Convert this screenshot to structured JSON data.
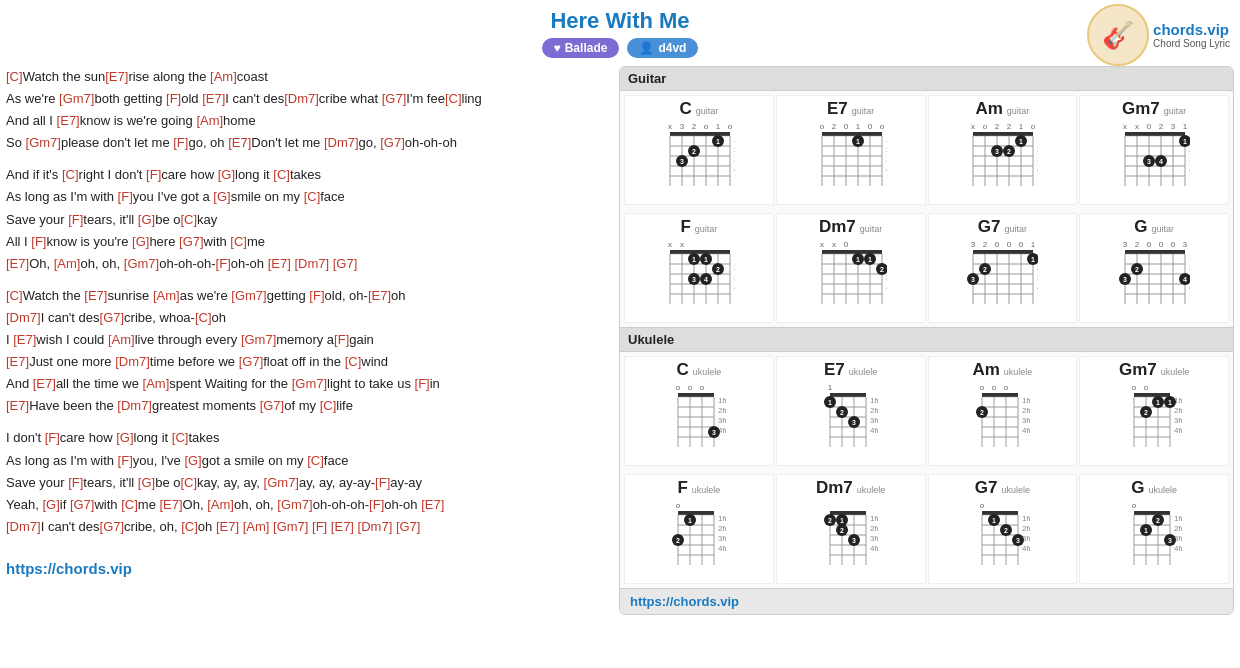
{
  "header": {
    "title": "Here With Me",
    "badge_ballade": "Ballade",
    "badge_user": "d4vd",
    "logo_icon": "🎸",
    "logo_brand": "chords.vip",
    "logo_sub": "Chord Song Lyric"
  },
  "lyrics": {
    "lines": [
      {
        "parts": [
          {
            "text": "[C]",
            "chord": true
          },
          {
            "text": "Watch the sun"
          },
          {
            "text": "[E7]",
            "chord": true
          },
          {
            "text": "rise along the "
          },
          {
            "text": "[Am]",
            "chord": true
          },
          {
            "text": "coast"
          }
        ]
      },
      {
        "parts": [
          {
            "text": "As we're "
          },
          {
            "text": "[Gm7]",
            "chord": true
          },
          {
            "text": "both getting "
          },
          {
            "text": "[F]",
            "chord": true
          },
          {
            "text": "old "
          },
          {
            "text": "[E7]",
            "chord": true
          },
          {
            "text": "I can't des"
          },
          {
            "text": "[Dm7]",
            "chord": true
          },
          {
            "text": "cribe what "
          },
          {
            "text": "[G7]",
            "chord": true
          },
          {
            "text": "I'm fee"
          },
          {
            "text": "[C]",
            "chord": true
          },
          {
            "text": "ling"
          }
        ]
      },
      {
        "parts": [
          {
            "text": "And all I "
          },
          {
            "text": "[E7]",
            "chord": true
          },
          {
            "text": "know is we're going "
          },
          {
            "text": "[Am]",
            "chord": true
          },
          {
            "text": "home"
          }
        ]
      },
      {
        "parts": [
          {
            "text": "So "
          },
          {
            "text": "[Gm7]",
            "chord": true
          },
          {
            "text": "please don't let me "
          },
          {
            "text": "[F]",
            "chord": true
          },
          {
            "text": "go, oh "
          },
          {
            "text": "[E7]",
            "chord": true
          },
          {
            "text": "Don't let me "
          },
          {
            "text": "[Dm7]",
            "chord": true
          },
          {
            "text": "go, "
          },
          {
            "text": "[G7]",
            "chord": true
          },
          {
            "text": "oh-oh-oh"
          }
        ]
      },
      {
        "spacer": true
      },
      {
        "parts": [
          {
            "text": "And if it's "
          },
          {
            "text": "[C]",
            "chord": true
          },
          {
            "text": "right I don't "
          },
          {
            "text": "[F]",
            "chord": true
          },
          {
            "text": "care how "
          },
          {
            "text": "[G]",
            "chord": true
          },
          {
            "text": "long it "
          },
          {
            "text": "[C]",
            "chord": true
          },
          {
            "text": "takes"
          }
        ]
      },
      {
        "parts": [
          {
            "text": "As long as I'm with "
          },
          {
            "text": "[F]",
            "chord": true
          },
          {
            "text": "you I've got a "
          },
          {
            "text": "[G]",
            "chord": true
          },
          {
            "text": "smile on my "
          },
          {
            "text": "[C]",
            "chord": true
          },
          {
            "text": "face"
          }
        ]
      },
      {
        "parts": [
          {
            "text": "Save your "
          },
          {
            "text": "[F]",
            "chord": true
          },
          {
            "text": "tears, it'll "
          },
          {
            "text": "[G]",
            "chord": true
          },
          {
            "text": "be o"
          },
          {
            "text": "[C]",
            "chord": true
          },
          {
            "text": "kay"
          }
        ]
      },
      {
        "parts": [
          {
            "text": "All I "
          },
          {
            "text": "[F]",
            "chord": true
          },
          {
            "text": "know is you're "
          },
          {
            "text": "[G]",
            "chord": true
          },
          {
            "text": "here "
          },
          {
            "text": "[G7]",
            "chord": true
          },
          {
            "text": "with "
          },
          {
            "text": "[C]",
            "chord": true
          },
          {
            "text": "me"
          }
        ]
      },
      {
        "parts": [
          {
            "text": "[E7]",
            "chord": true
          },
          {
            "text": "Oh, "
          },
          {
            "text": "[Am]",
            "chord": true
          },
          {
            "text": "oh, oh, "
          },
          {
            "text": "[Gm7]",
            "chord": true
          },
          {
            "text": "oh-oh-oh-"
          },
          {
            "text": "[F]",
            "chord": true
          },
          {
            "text": "oh-oh "
          },
          {
            "text": "[E7]",
            "chord": true
          },
          {
            "text": " "
          },
          {
            "text": "[Dm7]",
            "chord": true
          },
          {
            "text": " "
          },
          {
            "text": "[G7]",
            "chord": true
          }
        ]
      },
      {
        "spacer": true
      },
      {
        "parts": [
          {
            "text": "[C]",
            "chord": true
          },
          {
            "text": "Watch the "
          },
          {
            "text": "[E7]",
            "chord": true
          },
          {
            "text": "sunrise "
          },
          {
            "text": "[Am]",
            "chord": true
          },
          {
            "text": "as we're "
          },
          {
            "text": "[Gm7]",
            "chord": true
          },
          {
            "text": "getting "
          },
          {
            "text": "[F]",
            "chord": true
          },
          {
            "text": "old, oh-"
          },
          {
            "text": "[E7]",
            "chord": true
          },
          {
            "text": "oh"
          }
        ]
      },
      {
        "parts": [
          {
            "text": "[Dm7]",
            "chord": true
          },
          {
            "text": "I can't des"
          },
          {
            "text": "[G7]",
            "chord": true
          },
          {
            "text": "cribe, whoa-"
          },
          {
            "text": "[C]",
            "chord": true
          },
          {
            "text": "oh"
          }
        ]
      },
      {
        "parts": [
          {
            "text": "I "
          },
          {
            "text": "[E7]",
            "chord": true
          },
          {
            "text": "wish I could "
          },
          {
            "text": "[Am]",
            "chord": true
          },
          {
            "text": "live through every "
          },
          {
            "text": "[Gm7]",
            "chord": true
          },
          {
            "text": "memory a"
          },
          {
            "text": "[F]",
            "chord": true
          },
          {
            "text": "gain"
          }
        ]
      },
      {
        "parts": [
          {
            "text": "[E7]",
            "chord": true
          },
          {
            "text": "Just one more "
          },
          {
            "text": "[Dm7]",
            "chord": true
          },
          {
            "text": "time before we "
          },
          {
            "text": "[G7]",
            "chord": true
          },
          {
            "text": "float off in the "
          },
          {
            "text": "[C]",
            "chord": true
          },
          {
            "text": "wind"
          }
        ]
      },
      {
        "parts": [
          {
            "text": "And "
          },
          {
            "text": "[E7]",
            "chord": true
          },
          {
            "text": "all the time we "
          },
          {
            "text": "[Am]",
            "chord": true
          },
          {
            "text": "spent Waiting for the "
          },
          {
            "text": "[Gm7]",
            "chord": true
          },
          {
            "text": "light to take us "
          },
          {
            "text": "[F]",
            "chord": true
          },
          {
            "text": "in"
          }
        ]
      },
      {
        "parts": [
          {
            "text": "[E7]",
            "chord": true
          },
          {
            "text": "Have been the "
          },
          {
            "text": "[Dm7]",
            "chord": true
          },
          {
            "text": "greatest moments "
          },
          {
            "text": "[G7]",
            "chord": true
          },
          {
            "text": "of my "
          },
          {
            "text": "[C]",
            "chord": true
          },
          {
            "text": "life"
          }
        ]
      },
      {
        "spacer": true
      },
      {
        "parts": [
          {
            "text": "I don't "
          },
          {
            "text": "[F]",
            "chord": true
          },
          {
            "text": "care how "
          },
          {
            "text": "[G]",
            "chord": true
          },
          {
            "text": "long it "
          },
          {
            "text": "[C]",
            "chord": true
          },
          {
            "text": "takes"
          }
        ]
      },
      {
        "parts": [
          {
            "text": "As long as I'm with "
          },
          {
            "text": "[F]",
            "chord": true
          },
          {
            "text": "you, I've "
          },
          {
            "text": "[G]",
            "chord": true
          },
          {
            "text": "got a smile on my "
          },
          {
            "text": "[C]",
            "chord": true
          },
          {
            "text": "face"
          }
        ]
      },
      {
        "parts": [
          {
            "text": "Save your "
          },
          {
            "text": "[F]",
            "chord": true
          },
          {
            "text": "tears, it'll "
          },
          {
            "text": "[G]",
            "chord": true
          },
          {
            "text": "be o"
          },
          {
            "text": "[C]",
            "chord": true
          },
          {
            "text": "kay, ay, ay, "
          },
          {
            "text": "[Gm7]",
            "chord": true
          },
          {
            "text": "ay, ay, ay-ay-"
          },
          {
            "text": "[F]",
            "chord": true
          },
          {
            "text": "ay-ay"
          }
        ]
      },
      {
        "parts": [
          {
            "text": "Yeah, "
          },
          {
            "text": "[G]",
            "chord": true
          },
          {
            "text": "if "
          },
          {
            "text": "[G7]",
            "chord": true
          },
          {
            "text": "with "
          },
          {
            "text": "[C]",
            "chord": true
          },
          {
            "text": "me "
          },
          {
            "text": "[E7]",
            "chord": true
          },
          {
            "text": "Oh, "
          },
          {
            "text": "[Am]",
            "chord": true
          },
          {
            "text": "oh, oh, "
          },
          {
            "text": "[Gm7]",
            "chord": true
          },
          {
            "text": "oh-oh-oh-"
          },
          {
            "text": "[F]",
            "chord": true
          },
          {
            "text": "oh-oh "
          },
          {
            "text": "[E7]",
            "chord": true
          }
        ]
      },
      {
        "parts": [
          {
            "text": "[Dm7]",
            "chord": true
          },
          {
            "text": "I can't des"
          },
          {
            "text": "[G7]",
            "chord": true
          },
          {
            "text": "cribe, oh, "
          },
          {
            "text": "[C]",
            "chord": true
          },
          {
            "text": "oh "
          },
          {
            "text": "[E7]",
            "chord": true
          },
          {
            "text": " "
          },
          {
            "text": "[Am]",
            "chord": true
          },
          {
            "text": " "
          },
          {
            "text": "[Gm7]",
            "chord": true
          },
          {
            "text": " "
          },
          {
            "text": "[F]",
            "chord": true
          },
          {
            "text": " "
          },
          {
            "text": "[E7]",
            "chord": true
          },
          {
            "text": " "
          },
          {
            "text": "[Dm7]",
            "chord": true
          },
          {
            "text": " "
          },
          {
            "text": "[G7]",
            "chord": true
          }
        ]
      },
      {
        "spacer": true
      },
      {
        "website": "https://chords.vip"
      }
    ]
  },
  "chords_panel": {
    "guitar_label": "Guitar",
    "ukulele_label": "Ukulele",
    "footer": "https://chords.vip",
    "guitar_chords": [
      {
        "name": "C",
        "type": "guitar",
        "markers": "x,3,2,0,1,0",
        "dots": [
          {
            "fret": 1,
            "string": 2,
            "finger": "1"
          },
          {
            "fret": 2,
            "string": 4,
            "finger": "2"
          },
          {
            "fret": 3,
            "string": 5,
            "finger": "3"
          }
        ],
        "open": "x32010"
      },
      {
        "name": "E7",
        "type": "guitar",
        "dots": [
          {
            "fret": 1,
            "string": 3,
            "finger": "1"
          }
        ],
        "open": "020100"
      },
      {
        "name": "Am",
        "type": "guitar",
        "dots": [
          {
            "fret": 1,
            "string": 2,
            "finger": "1"
          },
          {
            "fret": 2,
            "string": 3,
            "finger": "2"
          },
          {
            "fret": 2,
            "string": 4,
            "finger": "3"
          }
        ],
        "open": "x02210"
      },
      {
        "name": "Gm7",
        "type": "guitar",
        "dots": [
          {
            "fret": 1,
            "string": 1,
            "finger": "1"
          },
          {
            "fret": 3,
            "string": 3,
            "finger": "3"
          },
          {
            "fret": 4,
            "string": 4,
            "finger": "4"
          }
        ],
        "open": "xx0231"
      }
    ],
    "guitar_chords2": [
      {
        "name": "F",
        "type": "guitar",
        "dots": [
          {
            "fret": 1,
            "string": 1,
            "finger": "1"
          },
          {
            "fret": 1,
            "string": 2,
            "finger": "1"
          },
          {
            "fret": 2,
            "string": 3,
            "finger": "2"
          },
          {
            "fret": 3,
            "string": 4,
            "finger": "3"
          },
          {
            "fret": 3,
            "string": 5,
            "finger": "4"
          }
        ],
        "open": "xx3211"
      },
      {
        "name": "Dm7",
        "type": "guitar",
        "dots": [
          {
            "fret": 1,
            "string": 1,
            "finger": "1"
          },
          {
            "fret": 1,
            "string": 2,
            "finger": "1"
          },
          {
            "fret": 2,
            "string": 3,
            "finger": "2"
          }
        ],
        "open": "xx0211"
      },
      {
        "name": "G7",
        "type": "guitar",
        "dots": [
          {
            "fret": 1,
            "string": 1,
            "finger": "1"
          },
          {
            "fret": 2,
            "string": 5,
            "finger": "2"
          },
          {
            "fret": 3,
            "string": 6,
            "finger": "3"
          }
        ],
        "open": "320001"
      },
      {
        "name": "G",
        "type": "guitar",
        "dots": [
          {
            "fret": 2,
            "string": 5,
            "finger": "2"
          },
          {
            "fret": 3,
            "string": 6,
            "finger": "3"
          },
          {
            "fret": 4,
            "string": 4,
            "finger": "4"
          }
        ],
        "open": "320003"
      }
    ],
    "ukulele_chords": [
      {
        "name": "C",
        "type": "ukulele"
      },
      {
        "name": "E7",
        "type": "ukulele"
      },
      {
        "name": "Am",
        "type": "ukulele"
      },
      {
        "name": "Gm7",
        "type": "ukulele"
      }
    ],
    "ukulele_chords2": [
      {
        "name": "F",
        "type": "ukulele"
      },
      {
        "name": "Dm7",
        "type": "ukulele"
      },
      {
        "name": "G7",
        "type": "ukulele"
      },
      {
        "name": "G",
        "type": "ukulele"
      }
    ]
  }
}
